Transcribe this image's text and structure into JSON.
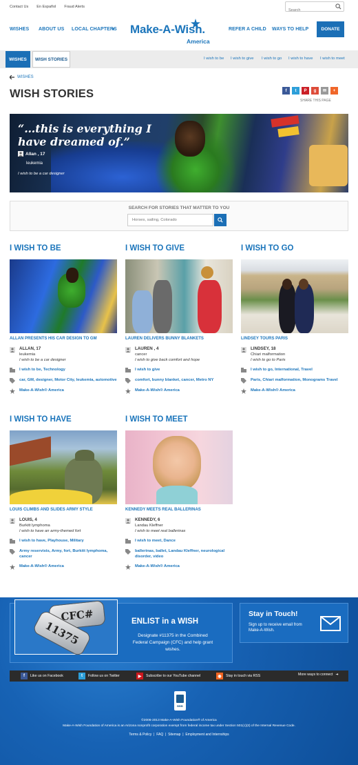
{
  "utility": {
    "links": [
      "Contact Us",
      "En Español",
      "Fraud Alerts"
    ],
    "search_placeholder": "Search"
  },
  "nav": {
    "wishes": "WISHES",
    "about": "ABOUT US",
    "local": "LOCAL CHAPTERS",
    "refer": "REFER A CHILD",
    "ways": "WAYS TO HELP",
    "donate": "DONATE"
  },
  "logo": {
    "text": "Make-A-Wish.",
    "sub": "America"
  },
  "subnav": {
    "tab_wishes": "WISHES",
    "tab_stories": "WISH STORIES",
    "links": [
      "I wish to be",
      "I wish to give",
      "I wish to go",
      "I wish to have",
      "I wish to meet"
    ]
  },
  "breadcrumb": "WISHES",
  "page_title": "WISH STORIES",
  "share_label": "SHARE THIS PAGE",
  "hero": {
    "quote": "“…this is everything I have dreamed of.”",
    "name": "Allan , 17",
    "condition": "leukemia",
    "wish": "I wish to be a car designer"
  },
  "story_search": {
    "label": "SEARCH FOR STORIES THAT MATTER TO YOU",
    "placeholder": "Horses, sailing, Colorado"
  },
  "categories": [
    {
      "heading": "I WISH TO BE",
      "story_title": "ALLAN PRESENTS HIS CAR DESIGN TO GM",
      "name": "ALLAN, 17",
      "condition": "leukemia",
      "wish": "I wish to be a car designer",
      "wish_tags": "I wish to be, Technology",
      "tags": "car, GM, designer, Motor City, leukemia, automotive",
      "chapter": "Make-A-Wish® America"
    },
    {
      "heading": "I WISH TO GIVE",
      "story_title": "LAUREN DELIVERS BUNNY BLANKETS",
      "name": "LAUREN , 4",
      "condition": "cancer",
      "wish": "I wish to give back comfort and hope",
      "wish_tags": "I wish to give",
      "tags": "comfort, bunny blanket, cancer, Metro NY",
      "chapter": "Make-A-Wish® America"
    },
    {
      "heading": "I WISH TO GO",
      "story_title": "LINDSEY TOURS PARIS",
      "name": "LINDSEY, 18",
      "condition": "Chiari malformation",
      "wish": "I wish to go to Paris",
      "wish_tags": "I wish to go, International, Travel",
      "tags": "Paris, Chiari malformation, Monograms Travel",
      "chapter": "Make-A-Wish® America"
    },
    {
      "heading": "I WISH TO HAVE",
      "story_title": "LOUIS CLIMBS AND SLIDES ARMY STYLE",
      "name": "LOUIS, 4",
      "condition": "Burkitt lymphoma",
      "wish": "I wish to have an army-themed fort",
      "wish_tags": "I wish to have, Playhouse, Military",
      "tags": "Army reservists, Army, fort, Burkitt lymphoma, cancer",
      "chapter": "Make-A-Wish® America"
    },
    {
      "heading": "I WISH TO MEET",
      "story_title": "KENNEDY MEETS REAL BALLERINAS",
      "name": "KENNEDY, 6",
      "condition": "Landau Kleffner",
      "wish": "I wish to meet real ballerinas",
      "wish_tags": "I wish to meet, Dance",
      "tags": "ballerinas, ballet, Landau Kleffner, neurological disorder, video",
      "chapter": "Make-A-Wish® America"
    }
  ],
  "footer": {
    "cfc_tag1": "CFC#",
    "cfc_tag2": "11375",
    "enlist_title": "ENLIST in a WISH",
    "enlist_desc": "Designate #11375 in the Combined Federal Campaign (CFC) and help grant wishes.",
    "touch_title": "Stay in Touch!",
    "touch_desc": "Sign up to receive email from Make-A-Wish.",
    "social": [
      "Like us on Facebook",
      "Follow us on Twitter",
      "Subscribe to our YouTube channel",
      "Stay in touch via RSS",
      "More ways to connect"
    ],
    "bbb": "BBB",
    "copyright": "©2006-2013 Make-A-Wish Foundation® of America",
    "legal": "Make-A-Wish Foundation of America is an Arizona nonprofit corporation exempt from federal income tax under Section 501(c)(3) of the Internal Revenue Code.",
    "links": [
      "Terms & Policy",
      "FAQ",
      "Sitemap",
      "Employment and Internships"
    ]
  },
  "colors": {
    "brand_blue": "#1b75bb",
    "donate_blue": "#1b6fb6"
  }
}
